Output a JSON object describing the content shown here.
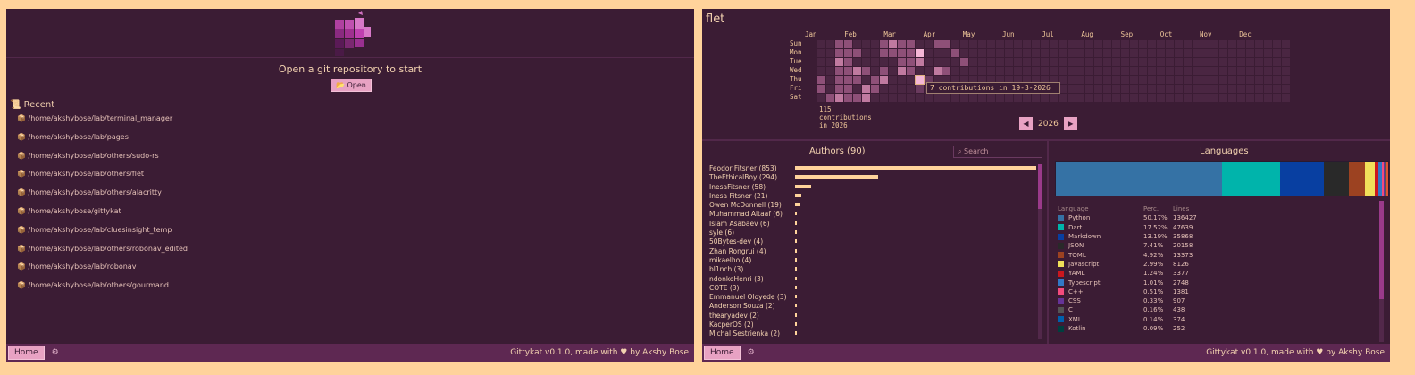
{
  "home": {
    "prompt": "Open a git repository to start",
    "open_label": "📂 Open",
    "recent_label": "📜 Recent",
    "recent": [
      "/home/akshybose/lab/terminal_manager",
      "/home/akshybose/lab/pages",
      "/home/akshybose/lab/others/sudo-rs",
      "/home/akshybose/lab/others/flet",
      "/home/akshybose/lab/others/alacritty",
      "/home/akshybose/gittykat",
      "/home/akshybose/lab/cluesinsight_temp",
      "/home/akshybose/lab/others/robonav_edited",
      "/home/akshybose/lab/robonav",
      "/home/akshybose/lab/others/gourmand"
    ]
  },
  "footer": {
    "home_label": "Home",
    "credit": "Gittykat v0.1.0, made with ♥ by Akshy Bose"
  },
  "repo": {
    "title": "flet",
    "heatmap": {
      "months": [
        "Jan",
        "Feb",
        "Mar",
        "Apr",
        "May",
        "Jun",
        "Jul",
        "Aug",
        "Sep",
        "Oct",
        "Nov",
        "Dec"
      ],
      "days": [
        "Sun",
        "Mon",
        "Tue",
        "Wed",
        "Thu",
        "Fri",
        "Sat"
      ],
      "levels": [
        "00220002322002200000000000000000000000000000000000000",
        "00222002222400020000000000000000000000000000000000000",
        "00320000022300002000000000000000000000000000000000000",
        "00223202032003200000000000000000000000000000000000000",
        "20222023000410000000000000000000000000000000000000000",
        "20220320000100000000000000000000000000000000000000000",
        "02322300000000000000000000000000000000000000000000000"
      ],
      "colors": [
        "#4a2642",
        "#6a3a5e",
        "#8e5078",
        "#c07aa0",
        "#f5b6d6"
      ],
      "tooltip": "7 contributions in 19-3-2026",
      "summary": "115 contributions in 2026",
      "year": "2026"
    },
    "authors": {
      "title": "Authors (90)",
      "search_placeholder": "⌕ Search",
      "list": [
        [
          "Feodor Fitsner (853)",
          853
        ],
        [
          "TheEthicalBoy (294)",
          294
        ],
        [
          "InesaFitsner (58)",
          58
        ],
        [
          "Inesa Fitsner (21)",
          21
        ],
        [
          "Owen McDonnell (19)",
          19
        ],
        [
          "Muhammad Altaaf (6)",
          6
        ],
        [
          "Islam Asabaev (6)",
          6
        ],
        [
          "syle (6)",
          6
        ],
        [
          "50Bytes-dev (4)",
          4
        ],
        [
          "Zhan Rongrui (4)",
          4
        ],
        [
          "mikaelho (4)",
          4
        ],
        [
          "bl1nch (3)",
          3
        ],
        [
          "ndonkoHenri (3)",
          3
        ],
        [
          "COTE (3)",
          3
        ],
        [
          "Emmanuel Oloyede (3)",
          3
        ],
        [
          "Anderson Souza (2)",
          2
        ],
        [
          "thearyadev (2)",
          2
        ],
        [
          "KacperOS (2)",
          2
        ],
        [
          "Michal Sestrienka (2)",
          2
        ]
      ]
    },
    "languages": {
      "title": "Languages",
      "headers": [
        "Language",
        "Perc.",
        "Lines"
      ],
      "list": [
        [
          "Python",
          "50.17%",
          "136427",
          "#3572a5"
        ],
        [
          "Dart",
          "17.52%",
          "47639",
          "#00b4ab"
        ],
        [
          "Markdown",
          "13.19%",
          "35868",
          "#083fa1"
        ],
        [
          "JSON",
          "7.41%",
          "20158",
          "#292929"
        ],
        [
          "TOML",
          "4.92%",
          "13373",
          "#9c4221"
        ],
        [
          "Javascript",
          "2.99%",
          "8126",
          "#f1e05a"
        ],
        [
          "YAML",
          "1.24%",
          "3377",
          "#cb171e"
        ],
        [
          "Typescript",
          "1.01%",
          "2748",
          "#3178c6"
        ],
        [
          "C++",
          "0.51%",
          "1381",
          "#f34b7d"
        ],
        [
          "CSS",
          "0.33%",
          "907",
          "#663399"
        ],
        [
          "C",
          "0.16%",
          "438",
          "#555555"
        ],
        [
          "XML",
          "0.14%",
          "374",
          "#0060ac"
        ],
        [
          "Kotlin",
          "0.09%",
          "252",
          "#003f3f"
        ]
      ]
    }
  }
}
